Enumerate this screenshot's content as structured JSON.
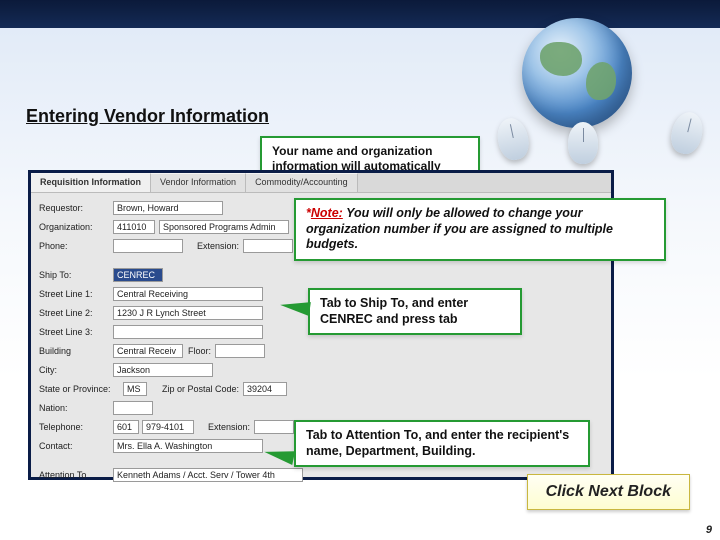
{
  "title": "Entering Vendor Information",
  "callouts": {
    "c1": "Your name and organization information will automatically populate.",
    "c2_prefix": "*",
    "c2_note": "Note:",
    "c2_rest": " You will only be allowed to change your organization number if you are assigned to multiple budgets.",
    "c3": "Tab to Ship To, and enter CENREC and press tab",
    "c4": "Tab to Attention To, and enter the recipient's  name, Department, Building."
  },
  "tabs": {
    "t1": "Requisition Information",
    "t2": "Vendor Information",
    "t3": "Commodity/Accounting"
  },
  "labels": {
    "requestor": "Requestor:",
    "organization": "Organization:",
    "phone": "Phone:",
    "extension": "Extension:",
    "ship_to": "Ship To:",
    "street1": "Street Line 1:",
    "street2": "Street Line 2:",
    "street3": "Street Line 3:",
    "building": "Building",
    "floor": "Floor:",
    "city": "City:",
    "state": "State or Province:",
    "zip": "Zip or Postal Code:",
    "nation": "Nation:",
    "telephone": "Telephone:",
    "contact": "Contact:",
    "attention": "Attention To"
  },
  "values": {
    "requestor": "Brown, Howard",
    "org_code": "411010",
    "org_name": "Sponsored Programs Admin",
    "ship_to": "CENREC",
    "street1": "Central Receiving",
    "street2": "1230 J R Lynch Street",
    "building": "Central Receiv",
    "city": "Jackson",
    "state": "MS",
    "zip": "39204",
    "tel_area": "601",
    "tel_num": "979-4101",
    "contact": "Mrs. Ella A. Washington",
    "attention": "Kenneth Adams / Acct. Serv / Tower 4th"
  },
  "next_block": "Click Next Block",
  "page_num": "9"
}
